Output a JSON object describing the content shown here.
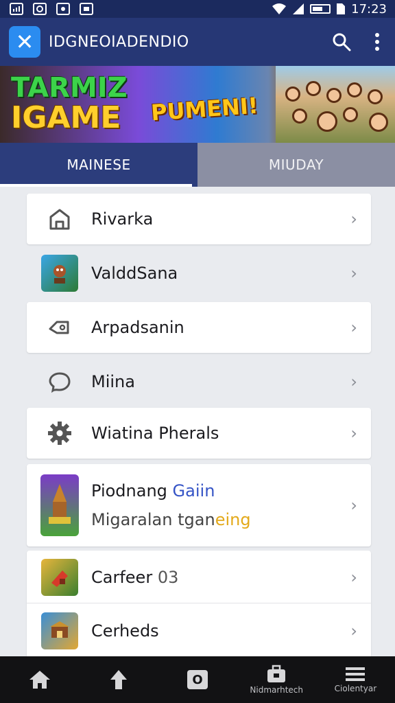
{
  "status_bar": {
    "time": "17:23"
  },
  "app_bar": {
    "title": "IDGNEOIADENDIO",
    "logo_glyph": "✕",
    "icons": [
      "search-icon",
      "more-vert-icon"
    ]
  },
  "banner": {
    "title_line1": "TARMIZ",
    "title_line2": "IGAME",
    "middle_text": "PUMENI!"
  },
  "tabs": [
    {
      "label": "MAINESE",
      "active": true
    },
    {
      "label": "MIUDAY",
      "active": false
    }
  ],
  "list": {
    "items": [
      {
        "label": "Rivarka",
        "icon": "home-icon"
      },
      {
        "label": "ValddSana",
        "icon": "game-thumbnail"
      },
      {
        "label": "Arpadsanin",
        "icon": "tag-icon"
      },
      {
        "label": "Miina",
        "icon": "chat-bubble-icon"
      },
      {
        "label": "Wiatina Pherals",
        "icon": "gear-icon"
      },
      {
        "label_main": "Piodnang",
        "label_accent": "Gaiin",
        "sub_main": "Migaralan",
        "sub_prefix": "tgan",
        "sub_accent": "eing",
        "icon": "game-thumbnail"
      },
      {
        "label_main": "Carfeer",
        "label_suffix": "03",
        "icon": "game-thumbnail"
      },
      {
        "label": "Cerheds",
        "icon": "game-thumbnail"
      }
    ]
  },
  "bottom_nav": [
    {
      "icon": "home-icon",
      "label": ""
    },
    {
      "icon": "arrow-up-icon",
      "label": ""
    },
    {
      "icon": "camera-icon",
      "label": "",
      "glyph": "O"
    },
    {
      "icon": "briefcase-icon",
      "label": "Nidmarhtech"
    },
    {
      "icon": "menu-icon",
      "label": "Ciolentyar"
    }
  ],
  "colors": {
    "app_bar": "#263775",
    "status_bar": "#1b2a5e",
    "accent": "#2b8cf0",
    "tab_active": "#2c3d7c",
    "tab_inactive": "#8b8fa3"
  }
}
